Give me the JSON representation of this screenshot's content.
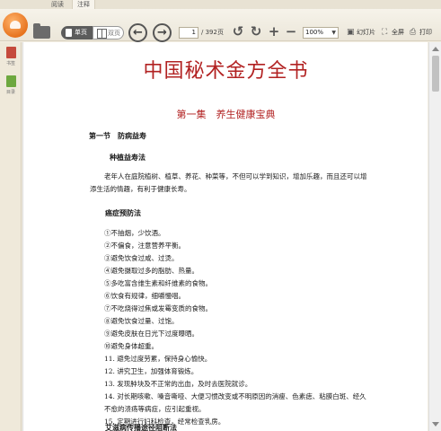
{
  "tabs": [
    {
      "label": "阅读"
    },
    {
      "label": "注释"
    }
  ],
  "toolbar": {
    "view_single": "单页",
    "view_double": "双页",
    "page_current": "1",
    "page_total": "/ 392页",
    "zoom": "100%",
    "slideshow": "幻灯片",
    "fullscreen": "全屏",
    "print": "打印"
  },
  "sidebar": {
    "items": [
      {
        "label": "书签"
      },
      {
        "label": "目录"
      }
    ]
  },
  "document": {
    "title": "中国秘术金方全书",
    "chapter": "第一集　养生健康宝典",
    "section": "第一节　防病益寿",
    "sub1": "种植益寿法",
    "para1": "老年人在庭院植树、植草、养花、种菜等，不但可以学到知识，增加乐趣，而且还可以增添生活的情趣，有利于健康长寿。",
    "sub2": "癌症预防法",
    "list": [
      "①不抽烟，少饮酒。",
      "②不偏食，注意营养平衡。",
      "③避免饮食过咸、过烫。",
      "④避免摄取过多的脂肪、热量。",
      "⑤多吃富含维生素和纤维素的食物。",
      "⑥饮食有规律，细嚼慢咽。",
      "⑦不吃烧得过焦或发霉变质的食物。",
      "⑧避免饮食过量、过饱。",
      "⑨避免皮肤在日光下过度曝晒。",
      "⑩避免身体超重。",
      "11. 避免过度劳累，保持身心愉快。",
      "12. 讲究卫生，加强体育锻炼。",
      "13. 发现肿块及不正常的出血，及时去医院就诊。",
      "14. 对长期咳嗽、嗓音嘶哑、大便习惯改变或不明原因的消瘦、色素痣、粘膜白斑、经久不愈的溃疡等病症，应引起重视。",
      "15. 定期进行妇科检查，经常检查乳房。"
    ],
    "sub3": "艾滋病传播途径阻断法"
  }
}
